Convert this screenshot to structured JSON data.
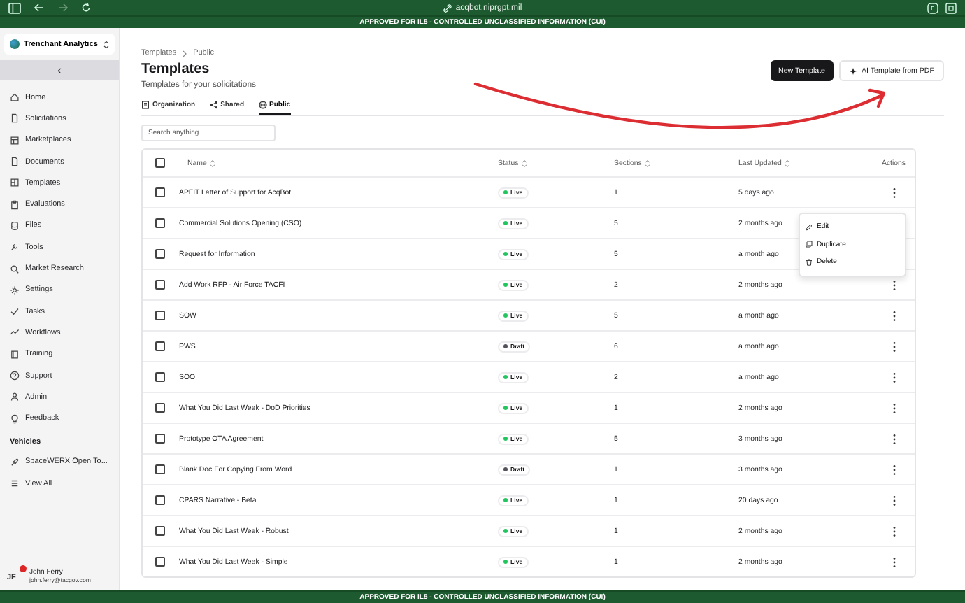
{
  "browser": {
    "url": "acqbot.niprgpt.mil",
    "forward_disabled": true
  },
  "banner_top": "APPROVED FOR IL5 - CONTROLLED UNCLASSIFIED INFORMATION (CUI)",
  "banner_bottom": "APPROVED FOR IL5 - CONTROLLED UNCLASSIFIED INFORMATION (CUI)",
  "sidebar": {
    "org": "Trenchant Analytics",
    "collapse": "‹",
    "items": [
      {
        "label": "Home"
      },
      {
        "label": "Solicitations"
      },
      {
        "label": "Marketplaces"
      },
      {
        "label": "Documents"
      },
      {
        "label": "Templates"
      },
      {
        "label": "Evaluations"
      },
      {
        "label": "Files"
      },
      {
        "label": "Tools"
      },
      {
        "label": "Market Research"
      },
      {
        "label": "Settings"
      },
      {
        "label": "Tasks"
      },
      {
        "label": "Workflows"
      },
      {
        "label": "Training"
      },
      {
        "label": "Support"
      },
      {
        "label": "Admin"
      },
      {
        "label": "Feedback"
      }
    ],
    "section_title": "Vehicles",
    "vehicles": [
      {
        "label": "SpaceWERX Open To..."
      },
      {
        "label": "View All"
      }
    ],
    "user": {
      "initials": "JF",
      "name": "John Ferry",
      "email": "john.ferry@tacgov.com",
      "notification": true
    }
  },
  "breadcrumb": [
    "Templates",
    "Public"
  ],
  "title": "Templates",
  "subtitle": "Templates for your solicitations",
  "buttons": {
    "primary": "New Template",
    "secondary": "AI Template from PDF"
  },
  "tabs": [
    {
      "label": "Organization",
      "selected": false
    },
    {
      "label": "Shared",
      "selected": false
    },
    {
      "label": "Public",
      "selected": true
    }
  ],
  "search": {
    "placeholder": "Search anything..."
  },
  "table": {
    "header_checked": false,
    "columns": [
      {
        "label": "Name",
        "sortable": true
      },
      {
        "label": "Status",
        "sortable": true
      },
      {
        "label": "Sections",
        "sortable": true
      },
      {
        "label": "Last Updated",
        "sortable": true
      },
      {
        "label": "Actions",
        "sortable": false
      }
    ],
    "rows": [
      {
        "checked": false,
        "name": "APFIT Letter of Support for AcqBot",
        "status": "Live",
        "color": "#22c55e",
        "sections": "1",
        "updated": "5 days ago",
        "actions_covered": false
      },
      {
        "checked": false,
        "name": "Commercial Solutions Opening (CSO)",
        "status": "Live",
        "color": "#22c55e",
        "sections": "5",
        "updated": "2 months ago",
        "actions_covered": true
      },
      {
        "checked": false,
        "name": "Request for Information",
        "status": "Live",
        "color": "#22c55e",
        "sections": "5",
        "updated": "a month ago",
        "actions_covered": true
      },
      {
        "checked": false,
        "name": "Add Work RFP - Air Force TACFI",
        "status": "Live",
        "color": "#22c55e",
        "sections": "2",
        "updated": "2 months ago",
        "actions_covered": false
      },
      {
        "checked": false,
        "name": "SOW",
        "status": "Live",
        "color": "#22c55e",
        "sections": "5",
        "updated": "a month ago",
        "actions_covered": false
      },
      {
        "checked": false,
        "name": "PWS",
        "status": "Draft",
        "color": "#52525b",
        "sections": "6",
        "updated": "a month ago",
        "actions_covered": false
      },
      {
        "checked": false,
        "name": "SOO",
        "status": "Live",
        "color": "#22c55e",
        "sections": "2",
        "updated": "a month ago",
        "actions_covered": false
      },
      {
        "checked": false,
        "name": "What You Did Last Week - DoD Priorities",
        "status": "Live",
        "color": "#22c55e",
        "sections": "1",
        "updated": "2 months ago",
        "actions_covered": false
      },
      {
        "checked": false,
        "name": "Prototype OTA Agreement",
        "status": "Live",
        "color": "#22c55e",
        "sections": "5",
        "updated": "3 months ago",
        "actions_covered": false
      },
      {
        "checked": false,
        "name": "Blank Doc For Copying From Word",
        "status": "Draft",
        "color": "#52525b",
        "sections": "1",
        "updated": "3 months ago",
        "actions_covered": false
      },
      {
        "checked": false,
        "name": "CPARS Narrative - Beta",
        "status": "Live",
        "color": "#22c55e",
        "sections": "1",
        "updated": "20 days ago",
        "actions_covered": false
      },
      {
        "checked": false,
        "name": "What You Did Last Week - Robust",
        "status": "Live",
        "color": "#22c55e",
        "sections": "1",
        "updated": "2 months ago",
        "actions_covered": false
      },
      {
        "checked": false,
        "name": "What You Did Last Week - Simple",
        "status": "Live",
        "color": "#22c55e",
        "sections": "1",
        "updated": "2 months ago",
        "actions_covered": false
      }
    ]
  },
  "context_menu": {
    "items": [
      {
        "label": "Edit"
      },
      {
        "label": "Duplicate"
      },
      {
        "label": "Delete"
      }
    ]
  }
}
